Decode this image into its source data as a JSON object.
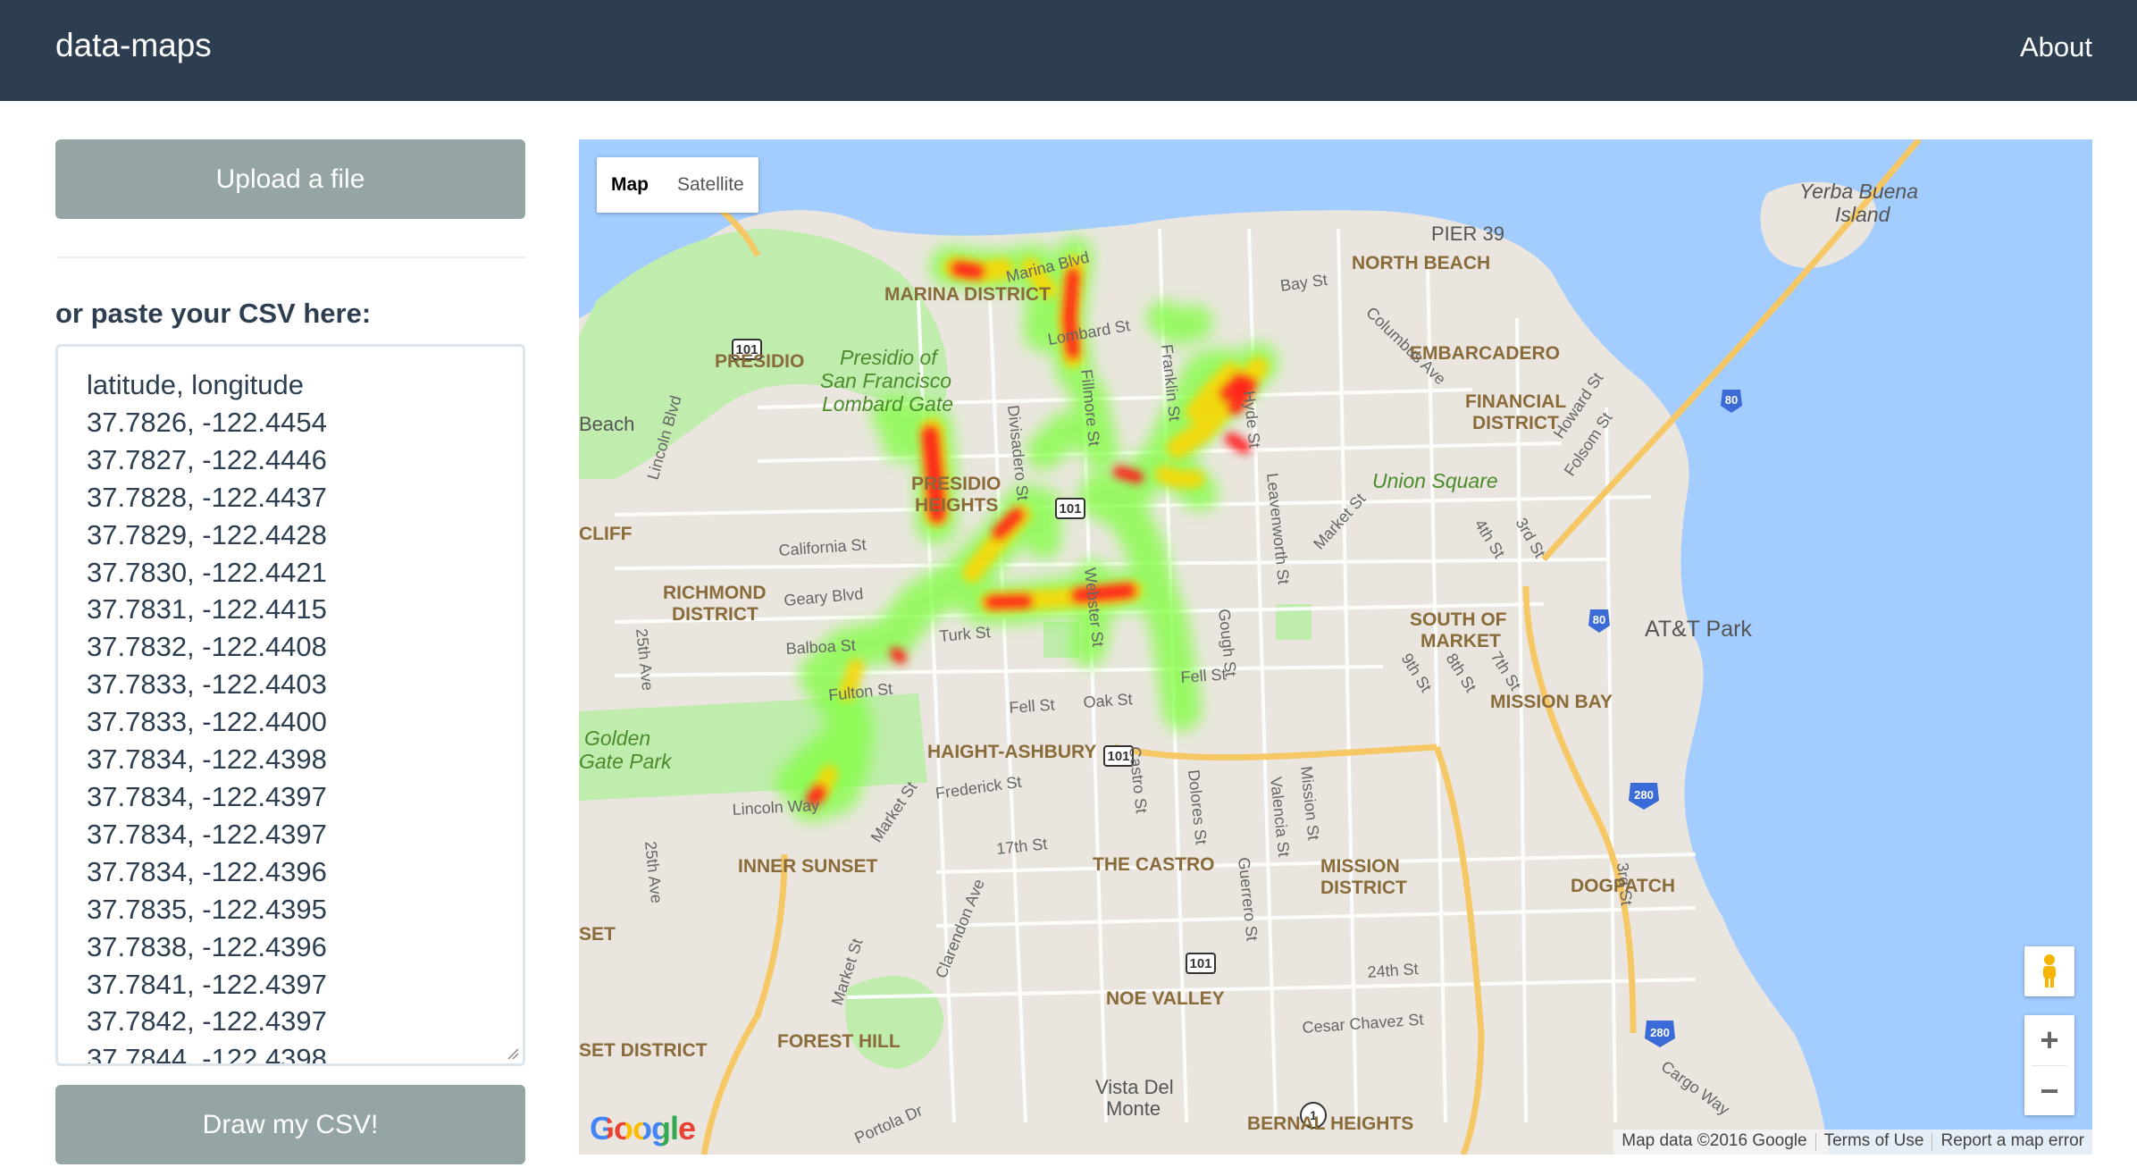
{
  "navbar": {
    "brand": "data-maps",
    "about": "About"
  },
  "sidebar": {
    "upload_label": "Upload a file",
    "paste_label": "or paste your CSV here:",
    "draw_label": "Draw my CSV!",
    "csv_text": "latitude, longitude\n37.7826, -122.4454\n37.7827, -122.4446\n37.7828, -122.4437\n37.7829, -122.4428\n37.7830, -122.4421\n37.7831, -122.4415\n37.7832, -122.4408\n37.7833, -122.4403\n37.7833, -122.4400\n37.7834, -122.4398\n37.7834, -122.4397\n37.7834, -122.4397\n37.7834, -122.4396\n37.7835, -122.4395\n37.7838, -122.4396\n37.7841, -122.4397\n37.7842, -122.4397\n37.7844, -122.4398"
  },
  "map": {
    "type_map": "Map",
    "type_satellite": "Satellite",
    "zoom_in": "+",
    "zoom_out": "−",
    "google": "Google",
    "attribution": "Map data ©2016 Google",
    "terms": "Terms of Use",
    "report": "Report a map error",
    "labels": {
      "pier39": "PIER 39",
      "north_beach": "NORTH BEACH",
      "marina_district": "MARINA DISTRICT",
      "marina_blvd": "Marina Blvd",
      "bay_st": "Bay St",
      "columbus_ave": "Columbus Ave",
      "embarcadero": "EMBARCADERO",
      "yerba_buena_1": "Yerba Buena",
      "yerba_buena_2": "Island",
      "presidio": "PRESIDIO",
      "presidio_of_1": "Presidio of",
      "presidio_of_2": "San Francisco",
      "presidio_of_3": "Lombard Gate",
      "lombard_st": "Lombard St",
      "financial_1": "FINANCIAL",
      "financial_2": "DISTRICT",
      "beach": "Beach",
      "lincoln_blvd": "Lincoln Blvd",
      "presidio_heights_1": "PRESIDIO",
      "presidio_heights_2": "HEIGHTS",
      "union_square": "Union Square",
      "cliff": "CLIFF",
      "california_st": "California St",
      "richmond_1": "RICHMOND",
      "richmond_2": "DISTRICT",
      "geary_blvd": "Geary Blvd",
      "balboa_st": "Balboa St",
      "turk_st": "Turk St",
      "south_of_1": "SOUTH OF",
      "south_of_2": "MARKET",
      "att_park": "AT&T Park",
      "fulton_st": "Fulton St",
      "fell_st": "Fell St",
      "oak_st": "Oak St",
      "fell_st_2": "Fell St",
      "mission_bay": "MISSION BAY",
      "golden_gate_1": "Golden",
      "golden_gate_2": "Gate Park",
      "haight_ashbury": "HAIGHT-ASHBURY",
      "frederick_st": "Frederick St",
      "lincoln_way": "Lincoln Way",
      "inner_sunset": "INNER SUNSET",
      "the_castro": "THE CASTRO",
      "mission_district_1": "MISSION",
      "mission_district_2": "DISTRICT",
      "dogpatch": "DOGPATCH",
      "seventeenth_st": "17th St",
      "set": "SET",
      "noe_valley": "NOE VALLEY",
      "twenty_fourth_st": "24th St",
      "set_district": "SET DISTRICT",
      "forest_hill": "FOREST HILL",
      "cesar_chavez": "Cesar Chavez St",
      "vista_del_1": "Vista Del",
      "vista_del_2": "Monte",
      "bernal_heights": "BERNAL HEIGHTS",
      "portola_dr": "Portola Dr",
      "cargo_way": "Cargo Way",
      "clarendon_ave": "Clarendon Ave",
      "castro_st": "Castro St",
      "webster_st": "Webster St",
      "divisadero_st": "Divisadero St",
      "fillmore_st": "Fillmore St",
      "franklin_st": "Franklin St",
      "hyde_st": "Hyde St",
      "leavenworth_st": "Leavenworth St",
      "gough_st": "Gough St",
      "market_st": "Market St",
      "howard_st": "Howard St",
      "folsom_st": "Folsom St",
      "third_st": "3rd St",
      "fourth_st": "4th St",
      "seventh_st": "7th St",
      "eighth_st": "8th St",
      "ninth_st": "9th St",
      "dolores_st": "Dolores St",
      "valencia_st": "Valencia St",
      "mission_st": "Mission St",
      "guerrero_st": "Guerrero St",
      "twentyfifth_ave": "25th Ave",
      "twentyfifth_ave_2": "25th Ave",
      "market_st_2": "Market St",
      "market_st_3": "Market St",
      "third_st_2": "3rd St",
      "hwy_101_a": "101",
      "hwy_101_b": "101",
      "hwy_101_c": "101",
      "hwy_101_d": "101",
      "hwy_80_a": "80",
      "hwy_80_b": "80",
      "hwy_280_a": "280",
      "hwy_280_b": "280",
      "hwy_1": "1"
    }
  },
  "colors": {
    "navbar": "#2c3e50",
    "button": "#95a5a6",
    "water": "#a3ccff",
    "park": "#c0ecae",
    "land": "#eae6df",
    "heat_hot": "#ff0000",
    "heat_warm": "#ffd000",
    "heat_cool": "#66ff00"
  }
}
